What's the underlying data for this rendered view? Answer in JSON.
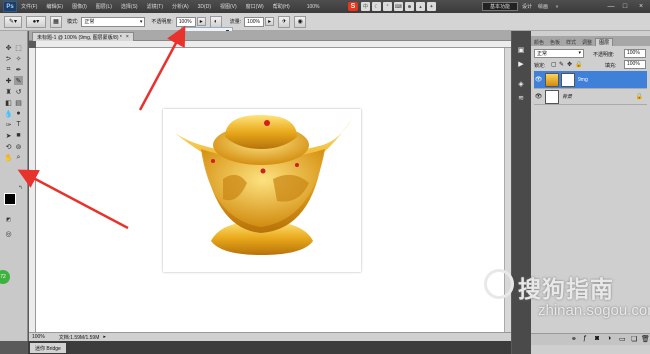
{
  "menubar": {
    "app_logo": "Ps",
    "items": [
      "文件(F)",
      "编辑(E)",
      "图像(I)",
      "图层(L)",
      "选择(S)",
      "滤镜(T)",
      "分析(A)",
      "3D(D)",
      "视图(V)",
      "窗口(W)",
      "帮助(H)"
    ],
    "zoom": "100%",
    "workspace_active": "基本功能",
    "workspace_items": [
      "设计",
      "绘画"
    ],
    "window_controls": [
      "—",
      "□",
      "×"
    ]
  },
  "options": {
    "mode_label": "模式:",
    "mode_value": "正常",
    "opacity_label": "不透明度:",
    "opacity_value": "100%",
    "flow_label": "流量:",
    "flow_value": "100%"
  },
  "document": {
    "tab_title": "未标题-1 @ 100% (9mg, 图层蒙版/8) *",
    "zoom_status": "100%",
    "doc_info": "文档:1.59M/1.59M"
  },
  "minibridge": {
    "label": "迷你 Bridge"
  },
  "layers_panel": {
    "tabs": [
      "颜色",
      "色板",
      "样式",
      "调整",
      "图层"
    ],
    "active_tab": "图层",
    "blend_mode": "正常",
    "opacity_label": "不透明度:",
    "opacity_value": "100%",
    "lock_label": "锁定:",
    "fill_label": "填充:",
    "fill_value": "100%",
    "layers": [
      {
        "name": "9mg",
        "selected": true
      },
      {
        "name": "背景",
        "selected": false
      }
    ]
  },
  "watermark": {
    "brand": "搜狗指南",
    "url": "zhinan.sogou.com"
  },
  "badge": {
    "text": "72"
  },
  "colors": {
    "foreground": "#000000",
    "background": "#ffffff",
    "arrow": "#e8322c",
    "selected_layer": "#3f80d8"
  }
}
